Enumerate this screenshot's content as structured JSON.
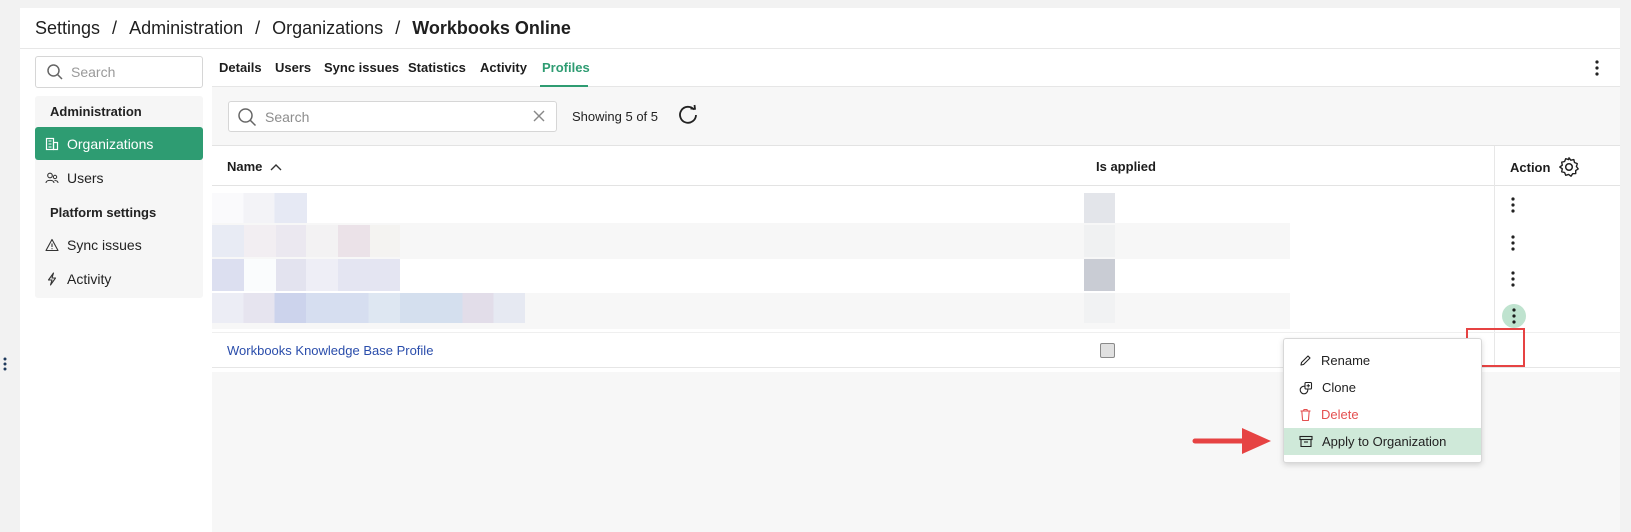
{
  "breadcrumb": {
    "items": [
      "Settings",
      "Administration",
      "Organizations"
    ],
    "separator": "/",
    "current": "Workbooks Online"
  },
  "sidebar": {
    "search_placeholder": "Search",
    "group_admin": "Administration",
    "item_organizations": "Organizations",
    "item_users": "Users",
    "group_platform": "Platform settings",
    "item_sync": "Sync issues",
    "item_activity": "Activity",
    "active_color": "#2e9c72"
  },
  "tabs": {
    "details": "Details",
    "users": "Users",
    "sync_issues": "Sync issues",
    "statistics": "Statistics",
    "activity": "Activity",
    "profiles": "Profiles",
    "active": "Profiles"
  },
  "toolbar": {
    "search_placeholder": "Search",
    "showing_text": "Showing 5 of 5"
  },
  "table": {
    "headers": {
      "name": "Name",
      "is_applied": "Is applied",
      "action": "Action"
    },
    "sort": "ascending",
    "visible_row_name": "Workbooks Knowledge Base Profile",
    "visible_row_applied": false
  },
  "context_menu": {
    "rename": "Rename",
    "clone": "Clone",
    "delete": "Delete",
    "apply": "Apply to Organization"
  },
  "colors": {
    "accent": "#2e9c72",
    "danger": "#e45050",
    "link": "#2a4dab",
    "highlight_box": "#e64343"
  }
}
